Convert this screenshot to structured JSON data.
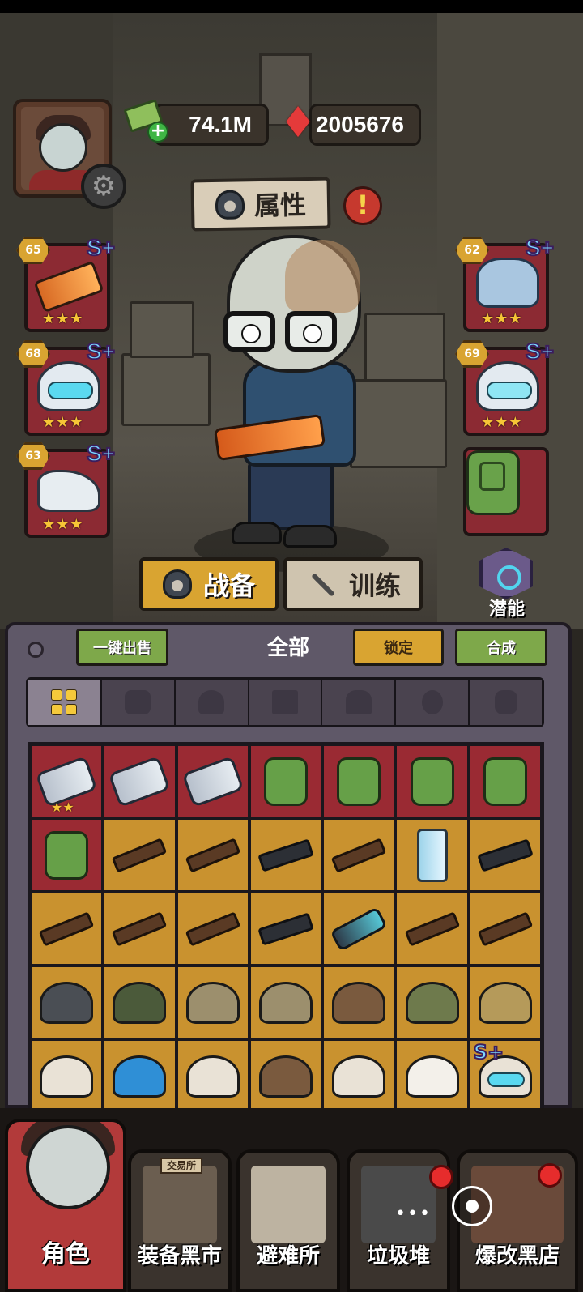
{
  "currency": {
    "cash": "74.1M",
    "gems": "2005676"
  },
  "attributes_button": "属性",
  "tabs": {
    "gear": "战备",
    "training": "训练"
  },
  "potential_label": "潜能",
  "equipment": {
    "left": [
      {
        "level": "65",
        "rank": "S+",
        "stars": "★★★",
        "icon": "assault-rifle-icon"
      },
      {
        "level": "68",
        "rank": "S+",
        "stars": "★★★",
        "icon": "helmet-icon"
      },
      {
        "level": "63",
        "rank": "S+",
        "stars": "★★★",
        "icon": "boots-icon"
      }
    ],
    "right": [
      {
        "level": "62",
        "rank": "S+",
        "stars": "★★★",
        "icon": "body-armor-icon"
      },
      {
        "level": "69",
        "rank": "S+",
        "stars": "★★★",
        "icon": "tactical-helmet-icon"
      },
      {
        "icon": "backpack-icon"
      }
    ]
  },
  "inventory": {
    "sell_all_label": "一键出售",
    "filter_label": "全部",
    "lock_label": "锁定",
    "merge_label": "合成",
    "categories": [
      "all-icon",
      "gun-icon",
      "helmet-icon",
      "pants-icon",
      "armor-icon",
      "mask-icon",
      "backpack-icon"
    ],
    "rows": [
      [
        {
          "kind": "rocket",
          "bg": "red",
          "stars": "★★"
        },
        {
          "kind": "rocket",
          "bg": "red"
        },
        {
          "kind": "rocket",
          "bg": "red"
        },
        {
          "kind": "bag",
          "bg": "red"
        },
        {
          "kind": "bag",
          "bg": "red"
        },
        {
          "kind": "bag",
          "bg": "red"
        },
        {
          "kind": "bag",
          "bg": "red"
        }
      ],
      [
        {
          "kind": "bag",
          "bg": "red"
        },
        {
          "kind": "sniper",
          "bg": "gold"
        },
        {
          "kind": "ak",
          "bg": "gold"
        },
        {
          "kind": "smg",
          "bg": "gold"
        },
        {
          "kind": "shotgun",
          "bg": "gold"
        },
        {
          "kind": "tube",
          "bg": "gold"
        },
        {
          "kind": "carbine",
          "bg": "gold"
        }
      ],
      [
        {
          "kind": "ak",
          "bg": "gold"
        },
        {
          "kind": "shotgun",
          "bg": "gold"
        },
        {
          "kind": "sniper",
          "bg": "gold"
        },
        {
          "kind": "scar",
          "bg": "gold"
        },
        {
          "kind": "plasma",
          "bg": "gold"
        },
        {
          "kind": "ak",
          "bg": "gold"
        },
        {
          "kind": "shotgun",
          "bg": "gold"
        }
      ],
      [
        {
          "kind": "helmet-dark",
          "bg": "gold"
        },
        {
          "kind": "helmet-green",
          "bg": "gold"
        },
        {
          "kind": "helmet-camo",
          "bg": "gold"
        },
        {
          "kind": "helmet-camo",
          "bg": "gold"
        },
        {
          "kind": "helmet-brown",
          "bg": "gold"
        },
        {
          "kind": "helmet-olive",
          "bg": "gold"
        },
        {
          "kind": "helmet-tan",
          "bg": "gold"
        }
      ],
      [
        {
          "kind": "helmet-white",
          "bg": "gold"
        },
        {
          "kind": "helmet-blue",
          "bg": "gold"
        },
        {
          "kind": "helmet-white",
          "bg": "gold"
        },
        {
          "kind": "helmet-brown",
          "bg": "gold"
        },
        {
          "kind": "helmet-white",
          "bg": "gold"
        },
        {
          "kind": "helmet-fluff",
          "bg": "gold"
        },
        {
          "kind": "helmet-visor",
          "bg": "gold",
          "rank": "S+"
        }
      ]
    ]
  },
  "bottom_nav": {
    "role": "角色",
    "market": "装备黑市",
    "market_sign": "交易所",
    "shelter": "避难所",
    "trash": "垃圾堆",
    "black_shop": "爆改黑店"
  },
  "colors": {
    "gold": "#d9a431",
    "red_slot": "#8c2a33",
    "green_button": "#7ea84a",
    "gem_red": "#e53a3a"
  }
}
